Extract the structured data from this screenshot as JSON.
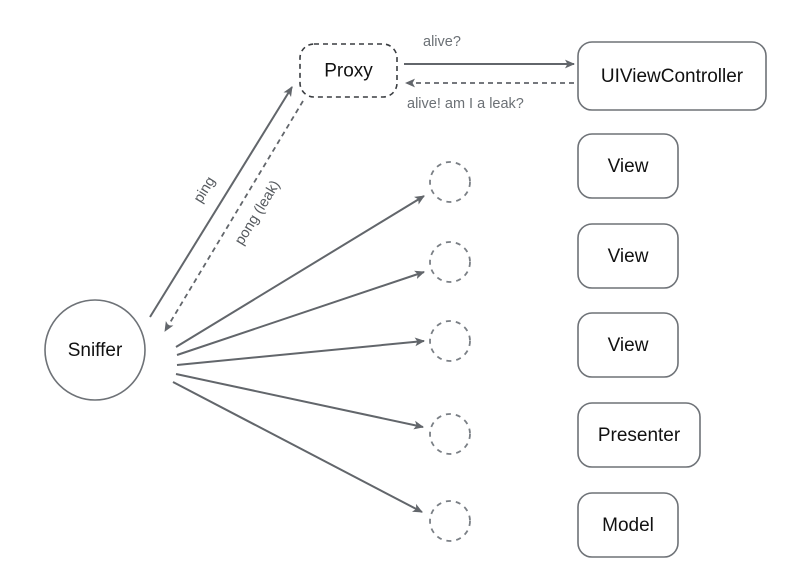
{
  "diagram": {
    "title": "Sniffer leak-detection proxy diagram",
    "colors": {
      "stroke": "#6e7277",
      "dashed_stroke": "#7a7f85",
      "text": "#111111",
      "label_text": "#6b7075",
      "background": "#ffffff"
    },
    "nodes": {
      "sniffer": {
        "label": "Sniffer",
        "shape": "circle",
        "border": "solid"
      },
      "proxy": {
        "label": "Proxy",
        "shape": "rounded-rect",
        "border": "dashed"
      },
      "uiviewcontroller": {
        "label": "UIViewController",
        "shape": "rounded-rect",
        "border": "solid"
      },
      "view_1": {
        "label": "View",
        "shape": "rounded-rect",
        "border": "solid"
      },
      "view_2": {
        "label": "View",
        "shape": "rounded-rect",
        "border": "solid"
      },
      "view_3": {
        "label": "View",
        "shape": "rounded-rect",
        "border": "solid"
      },
      "presenter": {
        "label": "Presenter",
        "shape": "rounded-rect",
        "border": "solid"
      },
      "model": {
        "label": "Model",
        "shape": "rounded-rect",
        "border": "solid"
      }
    },
    "ghost_nodes": [
      {
        "name": "ghost-proxy-1",
        "shape": "circle",
        "border": "dashed"
      },
      {
        "name": "ghost-proxy-2",
        "shape": "circle",
        "border": "dashed"
      },
      {
        "name": "ghost-proxy-3",
        "shape": "circle",
        "border": "dashed"
      },
      {
        "name": "ghost-proxy-4",
        "shape": "circle",
        "border": "dashed"
      },
      {
        "name": "ghost-proxy-5",
        "shape": "circle",
        "border": "dashed"
      }
    ],
    "edges": {
      "ping": {
        "label": "ping",
        "style": "solid",
        "from": "sniffer",
        "to": "proxy"
      },
      "pong": {
        "label": "pong (leak)",
        "style": "dashed",
        "from": "proxy",
        "to": "sniffer"
      },
      "alive_query": {
        "label": "alive?",
        "style": "solid",
        "from": "proxy",
        "to": "uiviewcontroller"
      },
      "alive_reply": {
        "label": "alive! am I a leak?",
        "style": "dashed",
        "from": "uiviewcontroller",
        "to": "proxy"
      }
    }
  }
}
